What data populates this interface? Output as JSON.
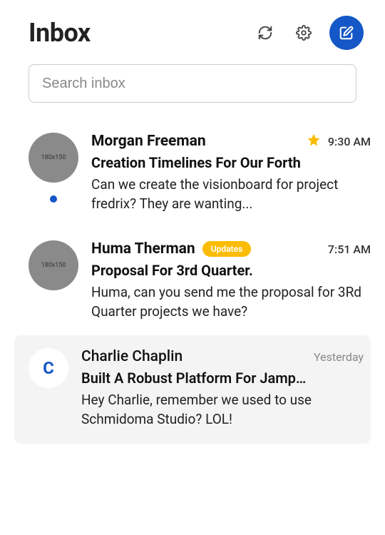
{
  "header": {
    "title": "Inbox"
  },
  "search": {
    "placeholder": "Search inbox"
  },
  "messages": [
    {
      "sender": "Morgan Freeman",
      "time": "9:30 AM",
      "subject": "Creation Timelines For Our Forth",
      "preview": "Can we create the visionboard for project fredrix? They are wanting...",
      "avatar_placeholder": "180x150"
    },
    {
      "sender": "Huma Therman",
      "time": "7:51 AM",
      "tag": "Updates",
      "subject": "Proposal For 3rd Quarter.",
      "preview": "Huma, can you send me the proposal for 3Rd Quarter projects we have?",
      "avatar_placeholder": "180x150"
    },
    {
      "sender": "Charlie Chaplin",
      "time": "Yesterday",
      "subject": "Built A Robust Platform For Jamp…",
      "preview": "Hey Charlie, remember we used to use Schmidoma Studio? LOL!",
      "avatar_letter": "C"
    }
  ]
}
